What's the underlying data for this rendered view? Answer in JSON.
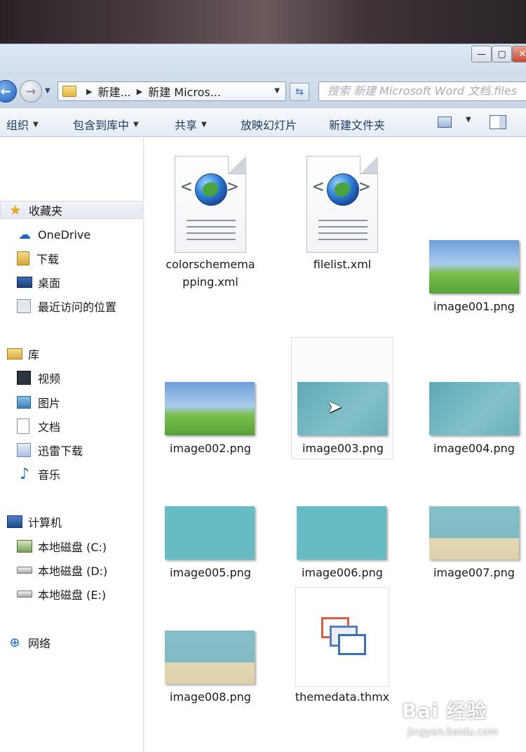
{
  "window_controls": {
    "minimize": "—",
    "maximize": "▢",
    "close": "✕"
  },
  "address": {
    "crumbs": [
      "新建...",
      "新建 Micros..."
    ]
  },
  "search": {
    "placeholder": "搜索 新建 Microsoft Word 文档.files"
  },
  "toolbar": {
    "organize": "组织",
    "include_in_library": "包含到库中",
    "share": "共享",
    "slideshow": "放映幻灯片",
    "new_folder": "新建文件夹"
  },
  "navpane": {
    "favorites": "收藏夹",
    "onedrive": "OneDrive",
    "downloads": "下载",
    "desktop": "桌面",
    "recent": "最近访问的位置",
    "libraries": "库",
    "videos": "视频",
    "pictures": "图片",
    "documents": "文档",
    "xunlei": "迅雷下载",
    "music": "音乐",
    "computer": "计算机",
    "drive_c": "本地磁盘 (C:)",
    "drive_d": "本地磁盘 (D:)",
    "drive_e": "本地磁盘 (E:)",
    "network": "网络"
  },
  "files": [
    {
      "name": "colorschememapping.xml",
      "line1": "colorschemema",
      "line2": "pping.xml",
      "kind": "xml"
    },
    {
      "name": "filelist.xml",
      "kind": "xml"
    },
    {
      "name": "image001.png",
      "kind": "png"
    },
    {
      "name": "image002.png",
      "kind": "png"
    },
    {
      "name": "image003.png",
      "kind": "png"
    },
    {
      "name": "image004.png",
      "kind": "png"
    },
    {
      "name": "image005.png",
      "kind": "png"
    },
    {
      "name": "image006.png",
      "kind": "png"
    },
    {
      "name": "image007.png",
      "kind": "png"
    },
    {
      "name": "image008.png",
      "kind": "png"
    },
    {
      "name": "themedata.thmx",
      "kind": "thmx"
    }
  ],
  "watermark": {
    "main": "Bai 经验",
    "sub": "jingyan.baidu.com"
  },
  "colors": {
    "accent": "#1d5fbd",
    "window_bg": "#f4f6fa",
    "folder": "#e2b43f"
  }
}
